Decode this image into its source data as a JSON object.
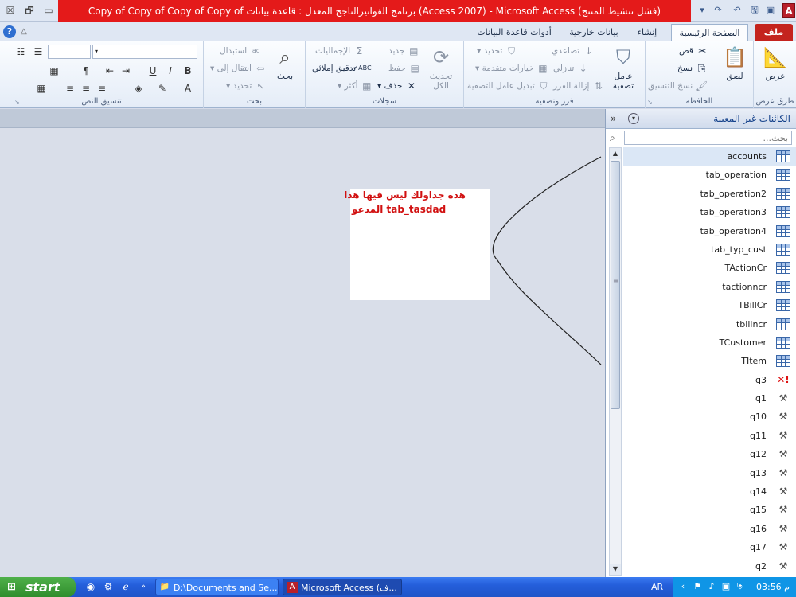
{
  "window": {
    "title": "Copy of Copy of Copy of Copy of برنامج الفواتيرالناجح المعدل : قاعدة بيانات (Access 2007) - Microsoft Access (فشل تنشيط المنتج)",
    "logo": "A"
  },
  "tabs": {
    "file": "ملف",
    "home": "الصفحة الرئيسية",
    "create": "إنشاء",
    "external": "بيانات خارجية",
    "dbtools": "أدوات قاعدة البيانات"
  },
  "ribbon": {
    "views": {
      "label": "طرق عرض",
      "view": "عرض"
    },
    "clipboard": {
      "label": "الحافظة",
      "paste": "لصق",
      "cut": "قص",
      "copy": "نسخ",
      "format_painter": "نسخ التنسيق"
    },
    "sort_filter": {
      "label": "فرز وتصفية",
      "filter": "عامل تصفية",
      "ascending": "تصاعدي",
      "descending": "تنازلي",
      "remove_sort": "إزالة الفرز",
      "selection": "تحديد",
      "advanced": "خيارات متقدمة",
      "toggle_filter": "تبديل عامل التصفية"
    },
    "records": {
      "label": "سجلات",
      "refresh_all": "تحديث الكل",
      "new": "جديد",
      "save": "حفظ",
      "delete": "حذف",
      "totals": "الإجماليات",
      "spelling": "تدقيق إملائي",
      "more": "أكثر"
    },
    "find": {
      "label": "بحث",
      "find": "بحث",
      "replace": "استبدال",
      "goto": "انتقال إلى",
      "select": "تحديد"
    },
    "text_formatting": {
      "label": "تنسيق النص"
    }
  },
  "workspace": {
    "note_line1": "هذه جداولك ليس فيها هذا",
    "note_line2": "المدعو  tab_tasdad"
  },
  "navpane": {
    "title": "الكائنات غير المعينة",
    "search_placeholder": "بحث...",
    "items": [
      {
        "label": "accounts",
        "type": "table",
        "selected": true
      },
      {
        "label": "tab_operation",
        "type": "table"
      },
      {
        "label": "tab_operation2",
        "type": "table"
      },
      {
        "label": "tab_operation3",
        "type": "table"
      },
      {
        "label": "tab_operation4",
        "type": "table"
      },
      {
        "label": "tab_typ_cust",
        "type": "table"
      },
      {
        "label": "TActionCr",
        "type": "table"
      },
      {
        "label": "tactionncr",
        "type": "table"
      },
      {
        "label": "TBillCr",
        "type": "table"
      },
      {
        "label": "tbillncr",
        "type": "table"
      },
      {
        "label": "TCustomer",
        "type": "table"
      },
      {
        "label": "TItem",
        "type": "table"
      },
      {
        "label": "q3",
        "type": "query-error"
      },
      {
        "label": "q1",
        "type": "query"
      },
      {
        "label": "q10",
        "type": "query"
      },
      {
        "label": "q11",
        "type": "query"
      },
      {
        "label": "q12",
        "type": "query"
      },
      {
        "label": "q13",
        "type": "query"
      },
      {
        "label": "q14",
        "type": "query"
      },
      {
        "label": "q15",
        "type": "query"
      },
      {
        "label": "q16",
        "type": "query"
      },
      {
        "label": "q17",
        "type": "query"
      },
      {
        "label": "q2",
        "type": "query"
      }
    ]
  },
  "taskbar": {
    "start": "start",
    "task1": "D:\\Documents and Se...",
    "task2": "Microsoft Access (ف...",
    "lang": "AR",
    "clock": "م 03:56"
  },
  "colors": {
    "title_red": "#e41a1a",
    "file_tab": "#c4241e",
    "note_text": "#d11010",
    "taskbar": "#245edb"
  }
}
